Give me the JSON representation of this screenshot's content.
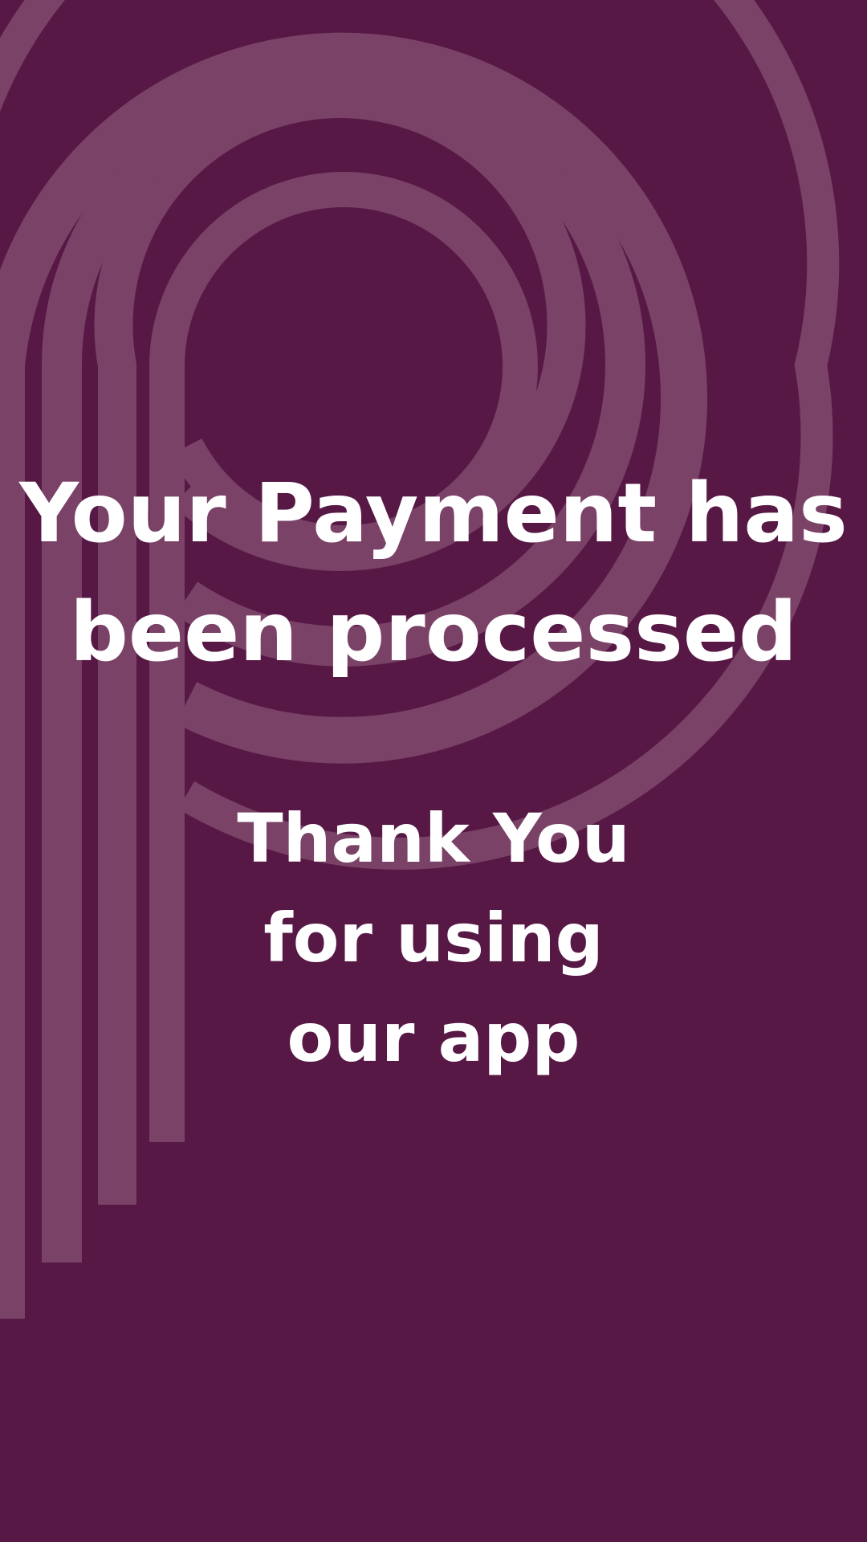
{
  "colors": {
    "background": "#571845",
    "ring": "#7a4267",
    "text": "#ffffff"
  },
  "background_graphic": {
    "icon": "concentric-p-logo-pattern"
  },
  "message": {
    "headline_line1": "Your Payment has",
    "headline_line2": "been processed",
    "thanks_line1": "Thank You",
    "thanks_line2": "for using",
    "thanks_line3": "our app"
  }
}
